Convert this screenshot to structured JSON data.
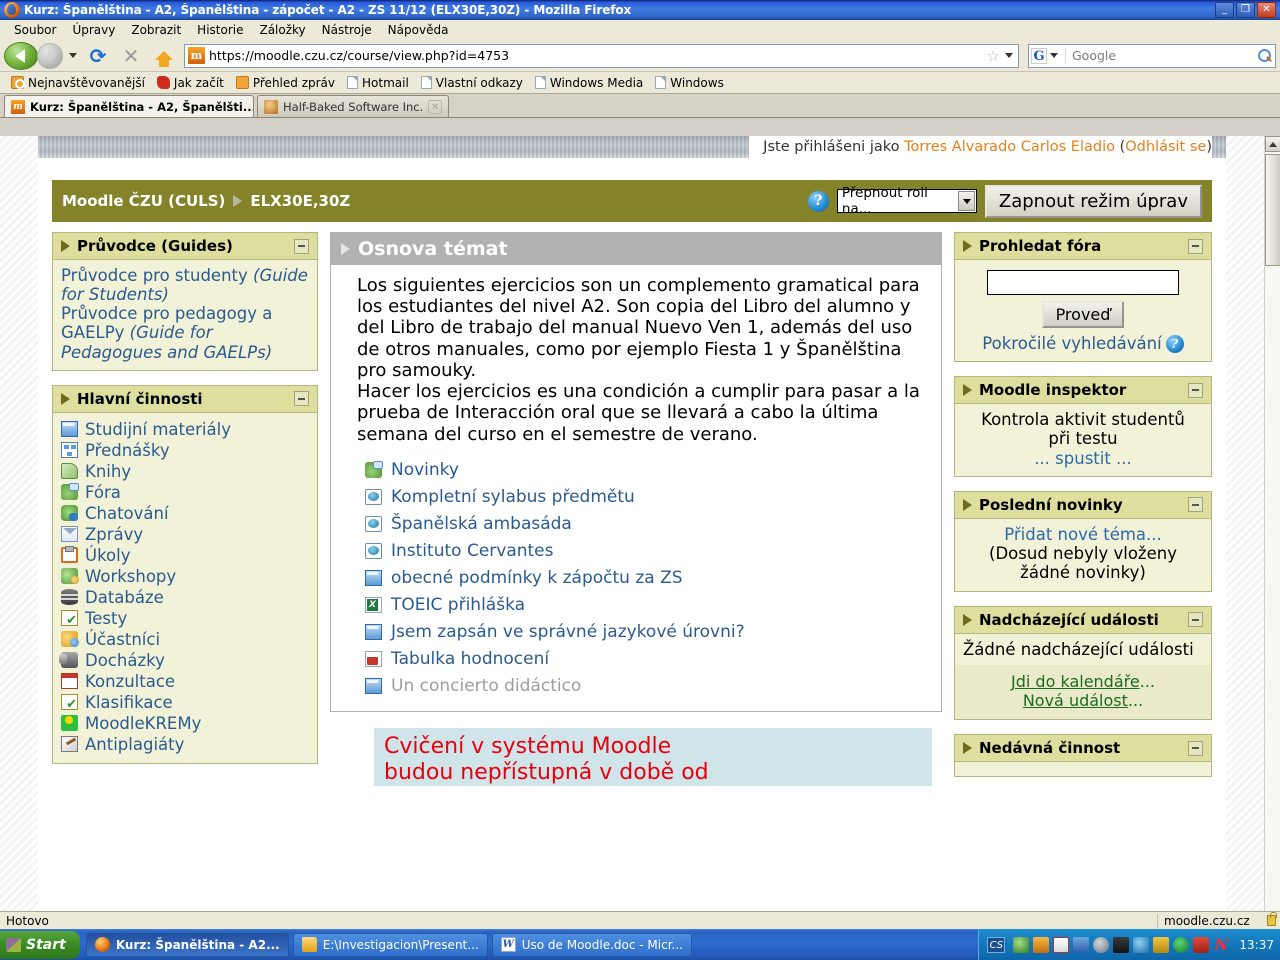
{
  "window": {
    "title": "Kurz: Španělština - A2, Španělština - zápočet - A2 - ZS 11/12 (ELX30E,30Z) - Mozilla Firefox",
    "minimize": "_",
    "maximize": "❐",
    "close": "✕"
  },
  "menu": [
    "Soubor",
    "Úpravy",
    "Zobrazit",
    "Historie",
    "Záložky",
    "Nástroje",
    "Nápověda"
  ],
  "toolbar": {
    "url": "https://moodle.czu.cz/course/view.php?id=4753",
    "favicon_letter": "m",
    "search_placeholder": "Google",
    "google_letter": "G",
    "reload_glyph": "⟳",
    "stop_glyph": "✕",
    "star_glyph": "☆"
  },
  "bookmarks": [
    {
      "label": "Nejnavštěvovanější",
      "icon": "folder-star-icon"
    },
    {
      "label": "Jak začít",
      "icon": "firefox-help-icon"
    },
    {
      "label": "Přehled zpráv",
      "icon": "rss-icon"
    },
    {
      "label": "Hotmail",
      "icon": "page-icon"
    },
    {
      "label": "Vlastní odkazy",
      "icon": "page-icon"
    },
    {
      "label": "Windows Media",
      "icon": "page-icon"
    },
    {
      "label": "Windows",
      "icon": "page-icon"
    }
  ],
  "tabs": [
    {
      "label": "Kurz: Španělština - A2, Španělšti...",
      "active": true,
      "close": "✕",
      "icon": "moodle-favicon"
    },
    {
      "label": "Half-Baked Software Inc.",
      "active": false,
      "close": "✕",
      "icon": "halfbaked-favicon"
    }
  ],
  "page": {
    "login_prefix": "Jste přihlášeni jako",
    "login_user": "Torres Alvarado Carlos Eladio",
    "logout_open": "(",
    "logout_label": "Odhlásit se",
    "logout_close": ")",
    "breadcrumb_root": "Moodle ČZU (CULS)",
    "breadcrumb_current": "ELX30E,30Z",
    "help_glyph": "?",
    "role_switch_label": "Přepnout roli na...",
    "edit_mode_button": "Zapnout režim úprav"
  },
  "left_blocks": [
    {
      "title": "Průvodce (Guides)",
      "collapse": "−",
      "links": [
        {
          "text": "Průvodce pro studenty ",
          "italic": "(Guide for Students)"
        },
        {
          "text": "Průvodce pro pedagogy a GAELPy ",
          "italic": "(Guide for Pedagogues and GAELPs)"
        }
      ]
    },
    {
      "title": "Hlavní činnosti",
      "collapse": "−",
      "items": [
        {
          "label": "Studijní materiály",
          "icon": "resource-window-icon",
          "cls": "window"
        },
        {
          "label": "Přednášky",
          "icon": "lesson-icon",
          "cls": "lesson"
        },
        {
          "label": "Knihy",
          "icon": "book-icon",
          "cls": "book"
        },
        {
          "label": "Fóra",
          "icon": "forum-icon",
          "cls": "forum"
        },
        {
          "label": "Chatování",
          "icon": "chat-icon",
          "cls": "chat"
        },
        {
          "label": "Zprávy",
          "icon": "message-envelope-icon",
          "cls": "mail"
        },
        {
          "label": "Úkoly",
          "icon": "assignment-clipboard-icon",
          "cls": "task"
        },
        {
          "label": "Workshopy",
          "icon": "workshop-icon",
          "cls": "workshop"
        },
        {
          "label": "Databáze",
          "icon": "database-icon",
          "cls": "db"
        },
        {
          "label": "Testy",
          "icon": "quiz-icon",
          "cls": "quiz"
        },
        {
          "label": "Účastníci",
          "icon": "participants-icon",
          "cls": "users"
        },
        {
          "label": "Docházky",
          "icon": "attendance-icon",
          "cls": "attend"
        },
        {
          "label": "Konzultace",
          "icon": "calendar-icon",
          "cls": "cal"
        },
        {
          "label": "Klasifikace",
          "icon": "grades-icon",
          "cls": "quiz"
        },
        {
          "label": "MoodleKREMy",
          "icon": "moodlekremy-icon",
          "cls": "kremy"
        },
        {
          "label": "Antiplagiáty",
          "icon": "antiplagiarism-icon",
          "cls": "anti"
        }
      ]
    }
  ],
  "main": {
    "topic_title": "Osnova témat",
    "summary_paragraphs": [
      "Los siguientes ejercicios son un complemento gramatical para los estudiantes del nivel A2. Son copia del Libro del alumno y del Libro de trabajo del manual Nuevo Ven 1, además del uso de otros manuales, como por ejemplo Fiesta 1 y Španělština pro samouky.",
      "Hacer los ejercicios es una condición a cumplir para pasar a la prueba de Interacción oral que se llevará a cabo la última semana del curso en el semestre de verano."
    ],
    "resources": [
      {
        "label": "Novinky",
        "icon": "forum-icon",
        "cls": "forum",
        "dim": false
      },
      {
        "label": "Kompletní sylabus předmětu",
        "icon": "url-link-icon",
        "cls": "url",
        "dim": false
      },
      {
        "label": "Španělská ambasáda",
        "icon": "url-link-icon",
        "cls": "url",
        "dim": false
      },
      {
        "label": "Instituto Cervantes",
        "icon": "url-link-icon",
        "cls": "url",
        "dim": false
      },
      {
        "label": "obecné podmínky k zápočtu za ZS",
        "icon": "resource-window-icon",
        "cls": "window",
        "dim": false
      },
      {
        "label": "TOEIC přihláška",
        "icon": "excel-file-icon",
        "cls": "xls",
        "dim": false
      },
      {
        "label": "Jsem zapsán ve správné jazykové úrovni?",
        "icon": "resource-window-icon",
        "cls": "window",
        "dim": false
      },
      {
        "label": "Tabulka hodnocení",
        "icon": "pdf-file-icon",
        "cls": "pdf",
        "dim": false
      },
      {
        "label": "Un concierto didáctico",
        "icon": "resource-window-icon",
        "cls": "window",
        "dim": true
      }
    ],
    "notice_line1": "Cvičení v systému Moodle",
    "notice_line2": "budou nepřístupná v době od"
  },
  "right_blocks": {
    "search_forums": {
      "title": "Prohledat fóra",
      "collapse": "−",
      "input_value": "",
      "button": "Proveď",
      "advanced_link": "Pokročilé vyhledávání",
      "help_glyph": "?"
    },
    "inspector": {
      "title": "Moodle inspektor",
      "collapse": "−",
      "line1": "Kontrola aktivit studentů",
      "line2": "při testu",
      "link": "... spustit ..."
    },
    "latest_news": {
      "title": "Poslední novinky",
      "collapse": "−",
      "add_link": "Přidat nové téma...",
      "empty_text": "(Dosud nebyly vloženy žádné novinky)"
    },
    "upcoming": {
      "title": "Nadcházející události",
      "collapse": "−",
      "empty_text": "Žádné nadcházející události",
      "calendar_link": "Jdi do kalendáře",
      "calendar_dots": "...",
      "new_event_link": "Nová událost",
      "new_event_dots": "..."
    },
    "recent_activity": {
      "title": "Nedávná činnost",
      "collapse": "−"
    }
  },
  "statusbar": {
    "status": "Hotovo",
    "domain": "moodle.czu.cz"
  },
  "taskbar": {
    "start": "Start",
    "buttons": [
      {
        "label": "Kurz: Španělština - A2...",
        "icon": "firefox-icon",
        "cls": "ff",
        "active": true
      },
      {
        "label": "E:\\Investigacion\\Present...",
        "icon": "folder-icon",
        "cls": "folder",
        "active": false
      },
      {
        "label": "Uso de Moodle.doc - Micr...",
        "icon": "word-icon",
        "cls": "word",
        "active": false
      }
    ],
    "language": "CS",
    "clock": "13:37"
  }
}
